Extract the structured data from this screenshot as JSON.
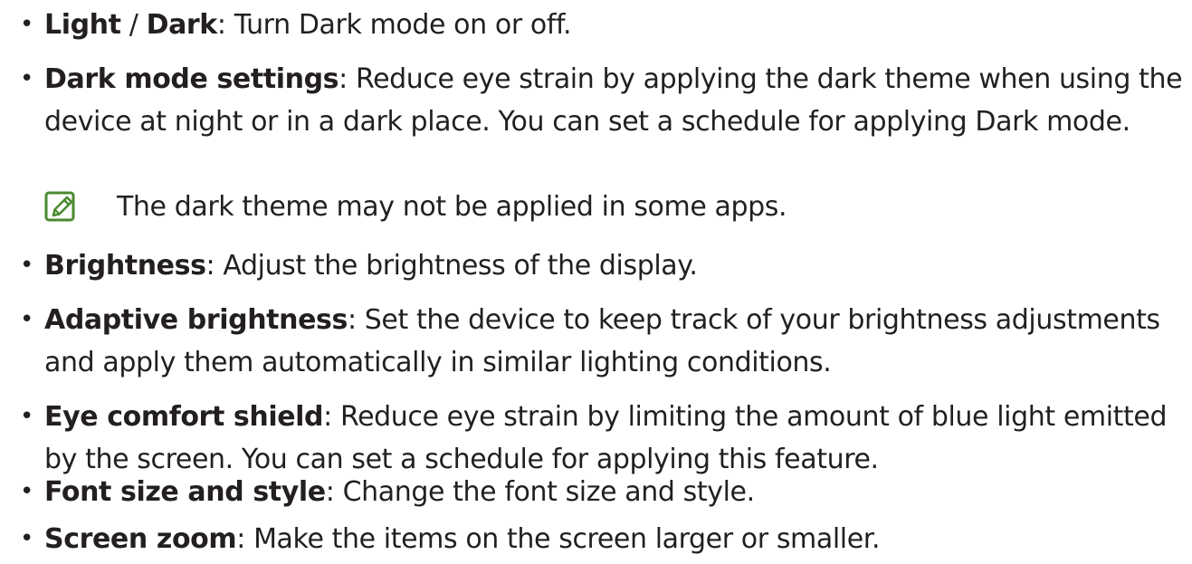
{
  "items": [
    {
      "term_a": "Light",
      "separator": " / ",
      "term_b": "Dark",
      "text": ": Turn Dark mode on or off."
    },
    {
      "term": "Dark mode settings",
      "line1": ": Reduce eye strain by applying the dark theme when using the",
      "line2": "device at night or in a dark place. You can set a schedule for applying Dark mode.",
      "note": {
        "icon": "note-pencil-icon",
        "text": "The dark theme may not be applied in some apps."
      }
    },
    {
      "term": "Brightness",
      "line1": ": Adjust the brightness of the display."
    },
    {
      "term": "Adaptive brightness",
      "line1": ": Set the device to keep track of your brightness adjustments",
      "line2": "and apply them automatically in similar lighting conditions."
    },
    {
      "term": "Eye comfort shield",
      "line1": ": Reduce eye strain by limiting the amount of blue light emitted",
      "line2": "by the screen. You can set a schedule for applying this feature."
    },
    {
      "term": "Font size and style",
      "line1": ": Change the font size and style."
    },
    {
      "term": "Screen zoom",
      "line1": ": Make the items on the screen larger or smaller."
    }
  ],
  "bullet_char": "•",
  "colors": {
    "text": "#231f20",
    "icon": "#4a8a2f"
  }
}
